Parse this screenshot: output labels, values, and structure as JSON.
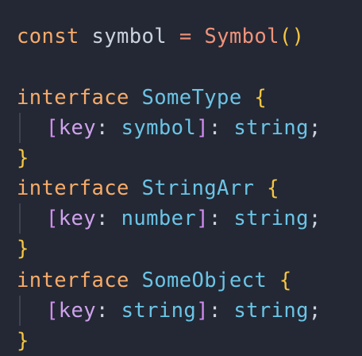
{
  "colors": {
    "background": "#232834",
    "keyword": "#f8ab6a",
    "identifier": "#cbd3de",
    "function": "#f0937a",
    "brace": "#f5c542",
    "type": "#6bc4e6",
    "bracket": "#d38cf0",
    "index_key": "#cfa2ec"
  },
  "code": {
    "line1": {
      "keyword": "const",
      "name": "symbol",
      "operator": "=",
      "call": "Symbol",
      "parens": "()"
    },
    "blocks": [
      {
        "keyword": "interface",
        "name": "SomeType",
        "open": "{",
        "bracket_open": "[",
        "key": "key",
        "colon1": ":",
        "key_type": "symbol",
        "bracket_close": "]",
        "colon2": ":",
        "value_type": "string",
        "semi": ";",
        "close": "}"
      },
      {
        "keyword": "interface",
        "name": "StringArr",
        "open": "{",
        "bracket_open": "[",
        "key": "key",
        "colon1": ":",
        "key_type": "number",
        "bracket_close": "]",
        "colon2": ":",
        "value_type": "string",
        "semi": ";",
        "close": "}"
      },
      {
        "keyword": "interface",
        "name": "SomeObject",
        "open": "{",
        "bracket_open": "[",
        "key": "key",
        "colon1": ":",
        "key_type": "string",
        "bracket_close": "]",
        "colon2": ":",
        "value_type": "string",
        "semi": ";",
        "close": "}"
      }
    ]
  }
}
